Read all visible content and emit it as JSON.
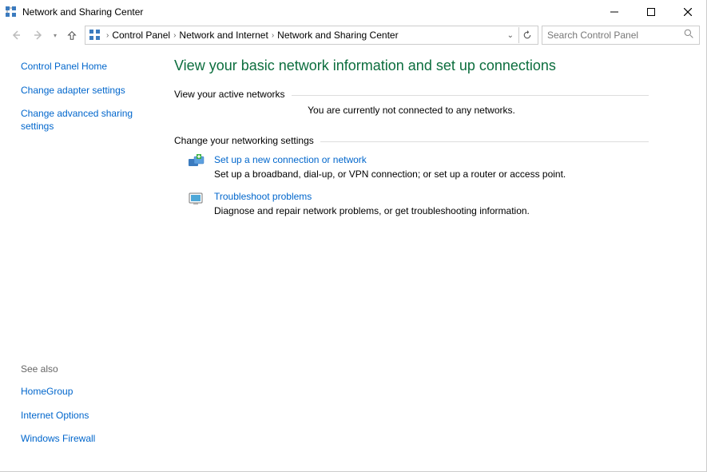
{
  "window": {
    "title": "Network and Sharing Center"
  },
  "breadcrumb": {
    "parts": [
      "Control Panel",
      "Network and Internet",
      "Network and Sharing Center"
    ]
  },
  "search": {
    "placeholder": "Search Control Panel"
  },
  "sidebar": {
    "home": "Control Panel Home",
    "links": [
      "Change adapter settings",
      "Change advanced sharing settings"
    ],
    "seealso_head": "See also",
    "seealso": [
      "HomeGroup",
      "Internet Options",
      "Windows Firewall"
    ]
  },
  "main": {
    "title": "View your basic network information and set up connections",
    "active_label": "View your active networks",
    "no_networks": "You are currently not connected to any networks.",
    "change_label": "Change your networking settings",
    "task_setup": {
      "link": "Set up a new connection or network",
      "desc": "Set up a broadband, dial-up, or VPN connection; or set up a router or access point."
    },
    "task_trouble": {
      "link": "Troubleshoot problems",
      "desc": "Diagnose and repair network problems, or get troubleshooting information."
    }
  }
}
